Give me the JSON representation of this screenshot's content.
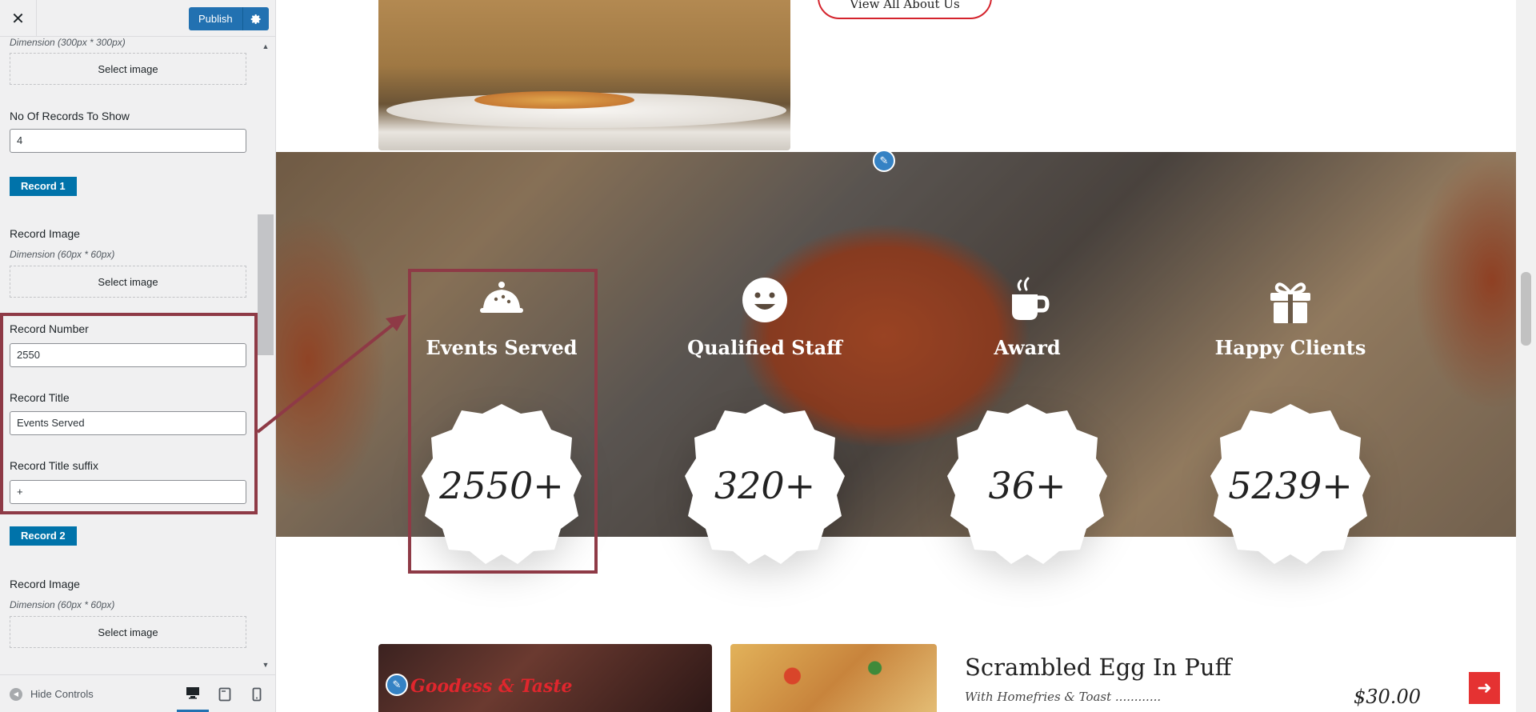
{
  "customizer": {
    "header": {
      "close_label": "✕",
      "publish_label": "Publish"
    },
    "fields": {
      "top_dimension": "Dimension (300px * 300px)",
      "select_image_1": "Select image",
      "records_label": "No Of Records To Show",
      "records_value": "4",
      "record1_badge": "Record 1",
      "record1_image_label": "Record Image",
      "record1_image_dimension": "Dimension (60px * 60px)",
      "select_image_2": "Select image",
      "record_number_label": "Record Number",
      "record_number_value": "2550",
      "record_title_label": "Record Title",
      "record_title_value": "Events Served",
      "record_suffix_label": "Record Title suffix",
      "record_suffix_value": "+",
      "record2_badge": "Record 2",
      "record2_image_label": "Record Image",
      "record2_image_dimension": "Dimension (60px * 60px)",
      "select_image_3": "Select image"
    },
    "footer": {
      "hide_controls_label": "Hide Controls",
      "active_device": "desktop"
    }
  },
  "preview": {
    "about_button": "View All About Us",
    "stats": [
      {
        "icon": "bowl-icon",
        "title": "Events Served",
        "value": "2550+"
      },
      {
        "icon": "smiley-icon",
        "title": "Qualified Staff",
        "value": "320+"
      },
      {
        "icon": "coffee-cup-icon",
        "title": "Award",
        "value": "36+"
      },
      {
        "icon": "gift-icon",
        "title": "Happy Clients",
        "value": "5239+"
      }
    ],
    "menu": {
      "script_text": "Goodess & Taste",
      "item_title": "Scrambled Egg In Puff",
      "item_subtitle": "With Homefries & Toast ............",
      "item_price": "$30.00"
    }
  },
  "colors": {
    "accent_blue": "#2271b1",
    "highlight": "#8e3a46",
    "brand_red": "#e53232"
  }
}
